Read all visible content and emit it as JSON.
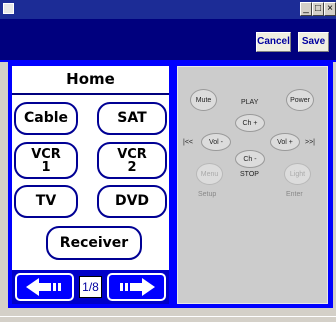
{
  "window": {
    "minimize_glyph": "_",
    "maximize_glyph": "□",
    "close_glyph": "×"
  },
  "toolbar": {
    "cancel_label": "Cancel",
    "save_label": "Save"
  },
  "devices": {
    "title": "Home",
    "items": [
      "Cable",
      "SAT",
      "VCR\n1",
      "VCR\n2",
      "TV",
      "DVD",
      "Receiver"
    ],
    "page_indicator": "1/8"
  },
  "remote": {
    "mute": "Mute",
    "power": "Power",
    "play": "PLAY",
    "ch_up": "Ch +",
    "ch_down": "Ch -",
    "vol_down": "Vol -",
    "vol_up": "Vol +",
    "prev_glyph": "|<<",
    "next_glyph": ">>|",
    "stop": "STOP",
    "menu": "Menu",
    "light": "Light",
    "setup": "Setup",
    "enter": "Enter"
  },
  "colors": {
    "accent": "#0000ff",
    "toolbar": "#00007e",
    "titlebar": "#1c2c96"
  }
}
